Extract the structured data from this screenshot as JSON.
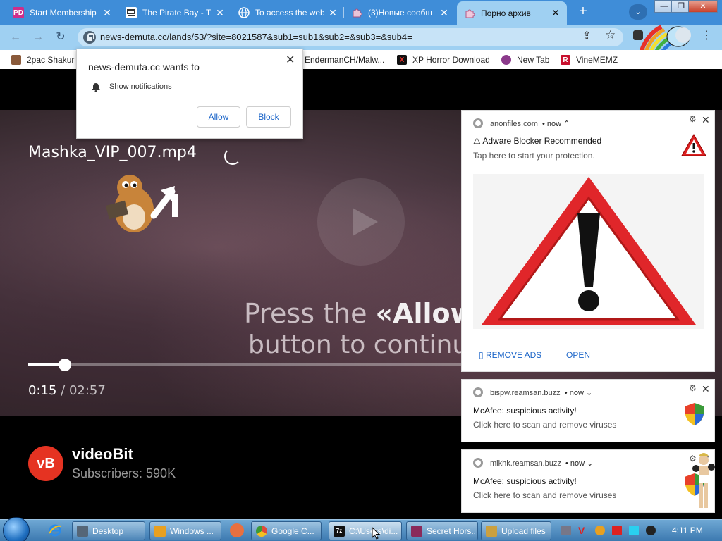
{
  "tabs": [
    {
      "label": "Start Membership",
      "icon": "pd-icon",
      "badge": "PD"
    },
    {
      "label": "The Pirate Bay - T",
      "icon": "pirate-ship-icon"
    },
    {
      "label": "To access the web",
      "icon": "globe-icon"
    },
    {
      "label": "(3)Новые сообщ",
      "icon": "puzzle-icon"
    },
    {
      "label": "Порно архив",
      "icon": "puzzle-icon"
    }
  ],
  "tab_close_glyph": "✕",
  "new_tab_glyph": "+",
  "tab_search_glyph": "⌄",
  "window_controls": {
    "minimize": "—",
    "restore": "❐",
    "close": "✕"
  },
  "toolbar": {
    "back_glyph": "←",
    "forward_glyph": "→",
    "reload_glyph": "↻",
    "url": "news-demuta.cc/lands/53/?site=8021587&sub1=sub1&sub2=&sub3=&sub4=",
    "share_glyph": "⇪",
    "star_glyph": "☆",
    "menu_glyph": "⋮"
  },
  "bookmarks": [
    {
      "label": "2pac Shakur -",
      "icon": "2pac-icon",
      "color": "#8a5a3a"
    },
    {
      "label": "EndermanCH/Malw...",
      "icon": "github-icon",
      "color": "#222222"
    },
    {
      "label": "XP Horror Download",
      "icon": "x-icon",
      "color": "#111111",
      "glyph": "X"
    },
    {
      "label": "New Tab",
      "icon": "new-tab-icon",
      "color": "#8b3a8b"
    },
    {
      "label": "VineMEMZ",
      "icon": "vine-icon",
      "color": "#c8102e",
      "glyph": "R"
    }
  ],
  "permission_popup": {
    "title": "news-demuta.cc wants to",
    "permission": "Show notifications",
    "allow": "Allow",
    "block": "Block",
    "close_glyph": "✕",
    "bell_glyph": "🔔"
  },
  "video": {
    "title": "Mashka_VIP_007.mp4",
    "press_prefix": "Press the ",
    "press_allow": "«Allow»",
    "press_line2": "button to continue",
    "elapsed": "0:15",
    "separator": " / ",
    "duration": "02:57",
    "progress_fraction": 0.0847
  },
  "channel": {
    "logo_text": "vB",
    "name": "videoBit",
    "subscribers": "Subscribers: 590K"
  },
  "notifications": [
    {
      "source": "anonfiles.com",
      "time": "• now ⌃",
      "title": "⚠ Adware Blocker Recommended",
      "body": "Tap here to start your protection.",
      "actions": [
        "▯ REMOVE ADS",
        "OPEN"
      ]
    },
    {
      "source": "bispw.reamsan.buzz",
      "time": "• now ⌄",
      "title": "McAfee: suspicious activity!",
      "body": "Click here to scan and remove viruses"
    },
    {
      "source": "mlkhk.reamsan.buzz",
      "time": "• now ⌄",
      "title": "McAfee: suspicious activity!",
      "body": "Click here to scan and remove viruses"
    }
  ],
  "notif_gear_glyph": "⚙",
  "notif_close_glyph": "✕",
  "warning_glyph": "!",
  "taskbar": {
    "items": [
      {
        "label": "Desktop",
        "icon": "desktop-icon",
        "color": "#556677"
      },
      {
        "label": "Windows ...",
        "icon": "media-player-icon",
        "color": "#e8a020"
      },
      {
        "label": "Google C...",
        "icon": "chrome-icon",
        "color": "#e04a3a"
      },
      {
        "label": "C:\\Users\\di...",
        "icon": "7zip-icon",
        "color": "#111111",
        "badge": "7z"
      },
      {
        "label": "Secret Hors...",
        "icon": "horse-icon",
        "color": "#8a2a5a"
      },
      {
        "label": "Upload files",
        "icon": "upload-icon",
        "color": "#caa040"
      }
    ],
    "clock": "4:11 PM"
  }
}
